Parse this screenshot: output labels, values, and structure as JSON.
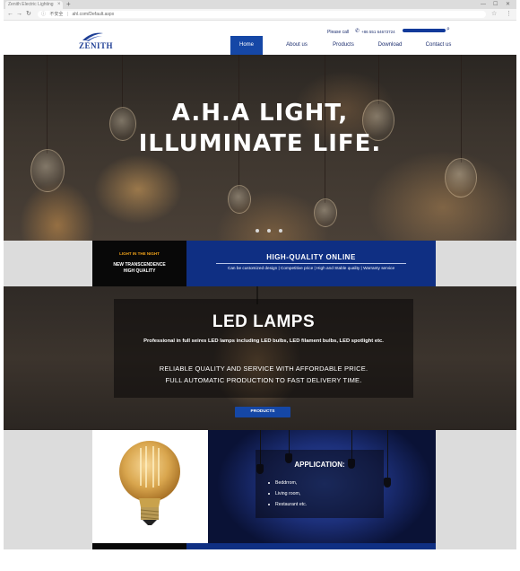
{
  "browser": {
    "tab_title": "Zenith Electric Lighting",
    "back": "←",
    "forward": "→",
    "reload": "↻",
    "secure_label": "不安全",
    "url": "ahl.com/Default.aspx"
  },
  "header": {
    "logo_text": "ZENITH",
    "call_label": "Please call",
    "phone": "+86 551 64673724",
    "nav": [
      "Home",
      "About us",
      "Products",
      "Download",
      "Contact us"
    ],
    "active_nav": "Home"
  },
  "hero": {
    "line1": "A.H.A LIGHT,",
    "line2": "ILLUMINATE LIFE.",
    "slide_count": 3
  },
  "strip": {
    "tag": "LIGHT IN THE NIGHT",
    "sub_line1": "NEW TRANSCENDENCE",
    "sub_line2": "HIGH QUALITY",
    "title": "HIGH-QUALITY ONLINE",
    "description": "Can be customized design | Competitive price | High and Stable quality | Warranty service"
  },
  "led": {
    "title": "LED LAMPS",
    "description": "Professional in full seires LED lamps including LED bulbs, LED filament bulbs, LED spotlight etc.",
    "line1": "RELIABLE QUALITY AND SERVICE WITH AFFORDABLE PRICE.",
    "line2": "FULL AUTOMATIC PRODUCTION TO FAST DELIVERY TIME.",
    "button": "PRODUCTS"
  },
  "application": {
    "title": "APPLICATION:",
    "items": [
      "Beddrrom,",
      "Living room,",
      "Restaurant etc."
    ]
  },
  "colors": {
    "brand_blue": "#1547a6",
    "navy": "#0f2f83",
    "accent_orange": "#f0a21a"
  }
}
